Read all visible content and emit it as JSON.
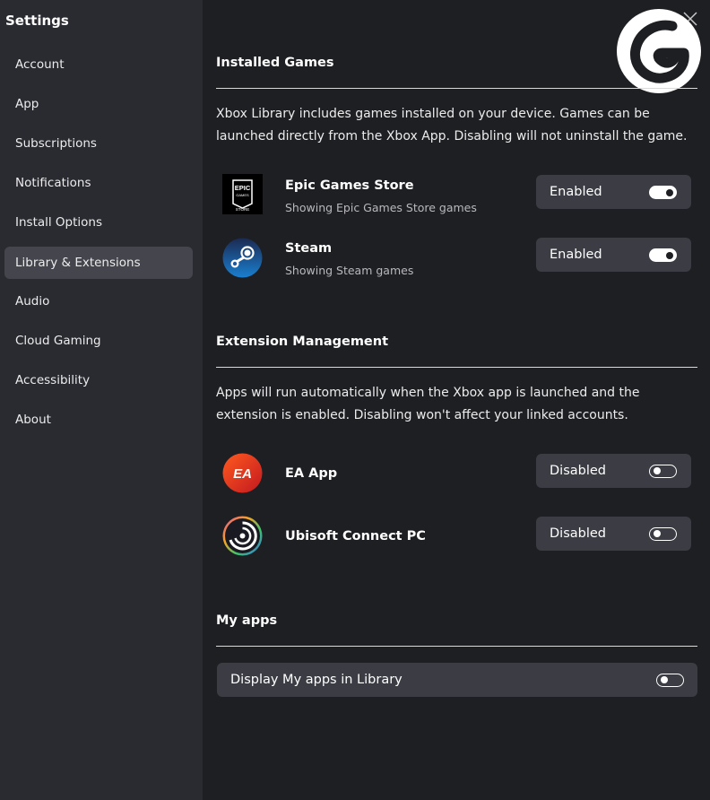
{
  "sidebar": {
    "title": "Settings",
    "items": [
      {
        "label": "Account"
      },
      {
        "label": "App"
      },
      {
        "label": "Subscriptions"
      },
      {
        "label": "Notifications"
      },
      {
        "label": "Install Options"
      },
      {
        "label": "Library & Extensions",
        "active": true
      },
      {
        "label": "Audio"
      },
      {
        "label": "Cloud Gaming"
      },
      {
        "label": "Accessibility"
      },
      {
        "label": "About"
      }
    ]
  },
  "installed_games": {
    "title": "Installed Games",
    "description": "Xbox Library includes games installed on your device. Games can be launched directly from the Xbox App. Disabling will not uninstall the game.",
    "items": [
      {
        "name": "Epic Games Store",
        "subtitle": "Showing Epic Games Store games",
        "state": "Enabled",
        "icon": "epic-games-icon",
        "icon_text": [
          "EPIC",
          "GAMES",
          "STORE"
        ]
      },
      {
        "name": "Steam",
        "subtitle": "Showing Steam games",
        "state": "Enabled",
        "icon": "steam-icon"
      }
    ]
  },
  "extension_management": {
    "title": "Extension Management",
    "description": "Apps will run automatically when the Xbox app is launched and the extension is enabled. Disabling won't affect your linked accounts.",
    "items": [
      {
        "name": "EA App",
        "state": "Disabled",
        "icon": "ea-app-icon",
        "icon_text": "EA"
      },
      {
        "name": "Ubisoft Connect PC",
        "state": "Disabled",
        "icon": "ubisoft-icon"
      }
    ]
  },
  "my_apps": {
    "title": "My apps",
    "row_label": "Display My apps in Library",
    "state": "off"
  },
  "colors": {
    "sidebar_bg": "#2a2b31",
    "main_bg": "#1e1f23",
    "card_bg": "#3b3c44",
    "active_nav_bg": "#45464d"
  }
}
